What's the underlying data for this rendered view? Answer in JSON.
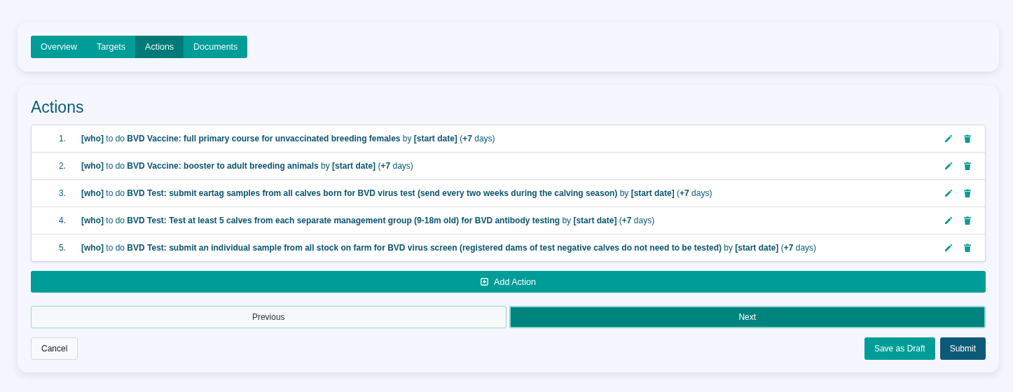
{
  "tabs": [
    {
      "label": "Overview",
      "selected": false
    },
    {
      "label": "Targets",
      "selected": false
    },
    {
      "label": "Actions",
      "selected": true
    },
    {
      "label": "Documents",
      "selected": false
    }
  ],
  "section_title": "Actions",
  "actions": [
    {
      "number": "1.",
      "text": "**[who]** to do **BVD Vaccine: full primary course for unvaccinated breeding females** by **[start date]** (**+7** days)"
    },
    {
      "number": "2.",
      "text": "**[who]** to do **BVD Vaccine: booster to adult breeding animals** by **[start date]** (**+7** days)"
    },
    {
      "number": "3.",
      "text": "**[who]** to do **BVD Test: submit eartag samples from all calves born for BVD virus test (send every two weeks during the calving season)** by **[start date]** (**+7** days)"
    },
    {
      "number": "4.",
      "text": "**[who]** to do **BVD Test: Test at least 5 calves from each separate management group (9-18m old) for BVD antibody testing** by **[start date]** (**+7** days)"
    },
    {
      "number": "5.",
      "text": "**[who]** to do **BVD Test: submit an individual sample from all stock on farm for BVD virus screen (registered dams of test negative calves do not need to be tested)** by **[start date]** (**+7** days)"
    }
  ],
  "add_button": "Add Action",
  "previous_button": "Previous",
  "next_button": "Next",
  "cancel_button": "Cancel",
  "save_draft_button": "Save as Draft",
  "submit_button": "Submit"
}
